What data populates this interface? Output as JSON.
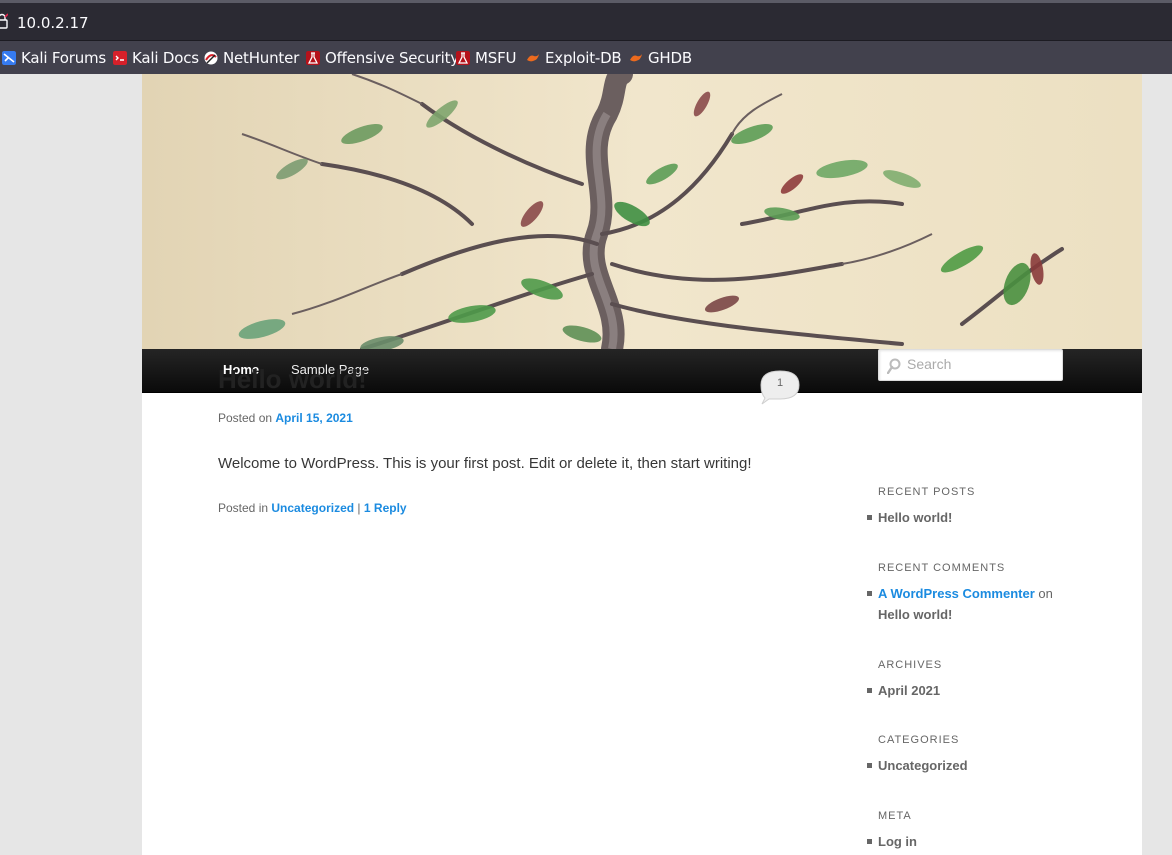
{
  "browser": {
    "url": "10.0.2.17",
    "bookmarks": [
      {
        "label": "Kali Forums",
        "icon": "kali-forums-icon",
        "color": "#367bf0"
      },
      {
        "label": "Kali Docs",
        "icon": "kali-docs-icon",
        "color": "#d6202a"
      },
      {
        "label": "NetHunter",
        "icon": "nethunter-icon",
        "color": "#d6202a"
      },
      {
        "label": "Offensive Security",
        "icon": "offsec-icon",
        "color": "#b5121b"
      },
      {
        "label": "MSFU",
        "icon": "msfu-icon",
        "color": "#b5121b"
      },
      {
        "label": "Exploit-DB",
        "icon": "exploit-db-icon",
        "color": "#ec6a1e"
      },
      {
        "label": "GHDB",
        "icon": "ghdb-icon",
        "color": "#ec6a1e"
      }
    ]
  },
  "nav": {
    "items": [
      {
        "label": "Home",
        "active": true
      },
      {
        "label": "Sample Page",
        "active": false
      }
    ]
  },
  "post": {
    "title": "Hello world!",
    "comment_count": "1",
    "posted_on_prefix": "Posted on",
    "date": "April 15, 2021",
    "content": "Welcome to WordPress. This is your first post. Edit or delete it, then start writing!",
    "posted_in_prefix": "Posted in",
    "category": "Uncategorized",
    "separator": "|",
    "reply_link": "1 Reply"
  },
  "sidebar": {
    "search_placeholder": "Search",
    "recent_posts": {
      "title": "RECENT POSTS",
      "items": [
        "Hello world!"
      ]
    },
    "recent_comments": {
      "title": "RECENT COMMENTS",
      "author": "A WordPress Commenter",
      "on": "on",
      "post": "Hello world!"
    },
    "archives": {
      "title": "ARCHIVES",
      "items": [
        "April 2021"
      ]
    },
    "categories": {
      "title": "CATEGORIES",
      "items": [
        "Uncategorized"
      ]
    },
    "meta": {
      "title": "META",
      "items": [
        "Log in"
      ]
    }
  },
  "colors": {
    "link": "#1b8be0",
    "nav_bg": "#1a1a1a"
  }
}
